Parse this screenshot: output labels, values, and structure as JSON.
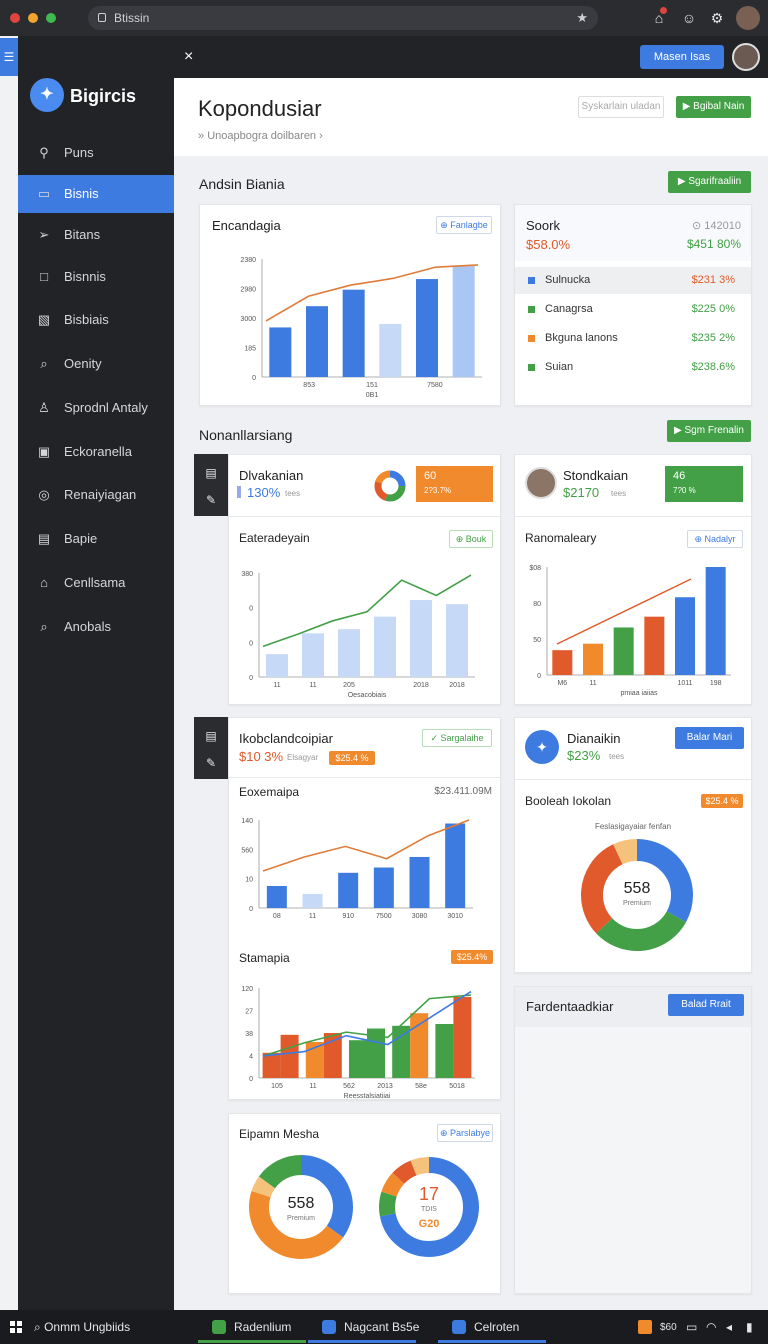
{
  "browser": {
    "url": "Btissin"
  },
  "app": {
    "name": "Bigircis",
    "close_label": "×",
    "master_button": "Masen Isas"
  },
  "sidebar": {
    "items": [
      {
        "label": "Puns",
        "icon": "pin-icon"
      },
      {
        "label": "Bisnis",
        "icon": "folder-icon",
        "active": true
      },
      {
        "label": "Bitans",
        "icon": "send-icon"
      },
      {
        "label": "Bisnnis",
        "icon": "square-icon"
      },
      {
        "label": "Bisbiais",
        "icon": "image-icon"
      },
      {
        "label": "Oenity",
        "icon": "search-icon"
      },
      {
        "label": "Sprodnl Antaly",
        "icon": "user-icon"
      },
      {
        "label": "Eckoranella",
        "icon": "window-icon"
      },
      {
        "label": "Renaiyiagan",
        "icon": "globe-icon"
      },
      {
        "label": "Bapie",
        "icon": "document-icon"
      },
      {
        "label": "Cenllsama",
        "icon": "home-icon"
      },
      {
        "label": "Anobals",
        "icon": "search-icon"
      }
    ]
  },
  "header": {
    "title": "Kopondusiar",
    "breadcrumb": "Unoapbogra doilbaren",
    "btn_outline": "Syskarlain uladan",
    "btn_green": "Bgibal Nain"
  },
  "section1": {
    "title": "Andsin Biania",
    "button": "Sgarifraaliin"
  },
  "card_a": {
    "title": "Encandagia",
    "chip": "Fanlagbe",
    "chart_data": {
      "type": "bar",
      "yticks": [
        "2380",
        "2980",
        "3000",
        "185",
        "0"
      ],
      "categories": [
        "",
        "853",
        "",
        "151",
        "",
        "7580",
        ""
      ],
      "xlabel": "0B1",
      "values": [
        0.42,
        0.6,
        0.74,
        0.45,
        0.83,
        0.94
      ],
      "line": [
        0.5,
        0.72,
        0.82,
        0.88,
        0.98,
        1.0
      ]
    }
  },
  "card_b": {
    "title": "Soork",
    "meta": "⊙ 142010",
    "value": "$58.0%",
    "value_right": "$451 80%",
    "rows": [
      {
        "label": "Sulnucka",
        "value": "$231 3%",
        "color": "#3d7be0",
        "vcolor": "#e05a2b"
      },
      {
        "label": "Canagrsa",
        "value": "$225 0%",
        "color": "#43a047",
        "vcolor": "#43a047"
      },
      {
        "label": "Bkguna lanons",
        "value": "$235 2%",
        "color": "#f08a2c",
        "vcolor": "#43a047"
      },
      {
        "label": "Suian",
        "value": "$238.6%",
        "color": "#43a047",
        "vcolor": "#43a047"
      }
    ]
  },
  "section2": {
    "title": "Nonanllarsiang",
    "button": "Sgm Frenalin"
  },
  "card_c": {
    "name": "Dlvakanian",
    "value": "130%",
    "sub": "tees",
    "badge_top": "60",
    "badge_bottom": "2?3.7%",
    "chart_title": "Eateradeyain",
    "chip": "Bouk",
    "chart_data": {
      "type": "bar",
      "yticks": [
        "380",
        "0",
        "0",
        "0"
      ],
      "categories": [
        "11",
        "11",
        "205",
        "",
        "2018",
        "2018"
      ],
      "xlabel": "Oesacobiais",
      "values": [
        0.22,
        0.42,
        0.46,
        0.58,
        0.74,
        0.7
      ],
      "line": [
        0.3,
        0.42,
        0.55,
        0.64,
        0.95,
        0.8,
        1.0
      ]
    }
  },
  "card_d": {
    "name": "Stondkaian",
    "value": "$2170",
    "sub": "tees",
    "badge_top": "46",
    "badge_bottom": "7?0 %",
    "chart_title": "Ranomaleary",
    "chip": "Nadalyr",
    "chart_data": {
      "type": "bar",
      "yticks": [
        "$08",
        "80",
        "50",
        "0"
      ],
      "categories": [
        "M6",
        "11",
        "",
        "",
        "1011",
        "198"
      ],
      "xlabel": "pmiaa iaiias",
      "values": [
        0.23,
        0.29,
        0.44,
        0.54,
        0.72,
        1.0
      ],
      "colors": [
        "#e05a2b",
        "#f08a2c",
        "#43a047",
        "#e05a2b",
        "#3d7be0",
        "#3d7be0"
      ]
    }
  },
  "card_e": {
    "title": "Ikobclandcoipiar",
    "value": "$10 3%",
    "sub": "Elsagyar",
    "orange": "$25.4 %",
    "chip": "Sargalaihe",
    "chart1_title": "Eoxemaipa",
    "chart1_value": "$23.411.09M",
    "chart1": {
      "type": "bar",
      "yticks": [
        "140",
        "560",
        "10",
        "0"
      ],
      "categories": [
        "08",
        "11",
        "910",
        "7500",
        "3080",
        "3010"
      ],
      "values": [
        0.25,
        0.16,
        0.4,
        0.46,
        0.58,
        0.96
      ],
      "line": [
        0.42,
        0.58,
        0.7,
        0.56,
        0.82,
        1.0
      ]
    },
    "chart2_title": "Stamapia",
    "chart2_orange": "$25.4%",
    "chart2": {
      "type": "bar",
      "yticks": [
        "120",
        "27",
        "38",
        "4",
        "0"
      ],
      "categories": [
        "105",
        "11",
        "562",
        "2013",
        "58e",
        "5018"
      ],
      "xlabel": "Reesstalsiatiiai",
      "groups": [
        [
          0.28,
          0.48
        ],
        [
          0.4,
          0.5
        ],
        [
          0.42,
          0.55
        ],
        [
          0.58,
          0.72
        ],
        [
          0.6,
          0.9
        ]
      ],
      "line1": [
        0.25,
        0.4,
        0.52,
        0.46,
        0.9,
        0.94
      ],
      "line2": [
        0.25,
        0.3,
        0.48,
        0.38,
        0.68,
        0.98
      ]
    }
  },
  "card_f": {
    "title": "Dianaikin",
    "value": "$23%",
    "sub": "tees",
    "button": "Balar Mari",
    "chart_title": "Booleah Iokolan",
    "orange": "$25.4 %",
    "donut_caption": "Feslasigayaiar fenfan",
    "donut_value": "558",
    "donut_sub": "Premium",
    "donut": [
      {
        "v": 0.33,
        "c": "#3d7be0"
      },
      {
        "v": 0.3,
        "c": "#43a047"
      },
      {
        "v": 0.3,
        "c": "#e05a2b"
      },
      {
        "v": 0.07,
        "c": "#f4c27a"
      }
    ]
  },
  "card_g": {
    "title": "Fardentaadkiar",
    "button": "Balad Rrait"
  },
  "card_h": {
    "title": "Eipamn Mesha",
    "chip": "Parslabye",
    "donut1_value": "558",
    "donut1_sub": "Premium",
    "donut2_value": "17",
    "donut2_sub": "TDIS",
    "donut2_logo": "G20",
    "donut1": [
      {
        "v": 0.35,
        "c": "#3d7be0"
      },
      {
        "v": 0.45,
        "c": "#f08a2c"
      },
      {
        "v": 0.05,
        "c": "#f4c27a"
      },
      {
        "v": 0.15,
        "c": "#43a047"
      }
    ],
    "donut2": [
      {
        "v": 0.72,
        "c": "#3d7be0"
      },
      {
        "v": 0.08,
        "c": "#43a047"
      },
      {
        "v": 0.07,
        "c": "#f08a2c"
      },
      {
        "v": 0.07,
        "c": "#e05a2b"
      },
      {
        "v": 0.06,
        "c": "#f4c27a"
      }
    ]
  },
  "taskbar": {
    "search": "Onmm Ungbiids",
    "apps": [
      {
        "label": "Radenlium",
        "color": "#43a047"
      },
      {
        "label": "Nagcant Bs5e",
        "color": "#3d7be0"
      },
      {
        "label": "Celroten",
        "color": "#3d7be0"
      }
    ],
    "tray_text": "$60"
  }
}
